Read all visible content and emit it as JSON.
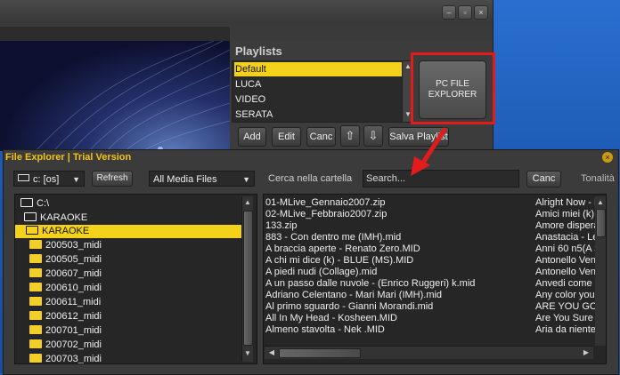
{
  "playlists": {
    "title": "Playlists",
    "items": [
      "Default",
      "LUCA",
      "VIDEO",
      "SERATA"
    ],
    "selected_index": 0,
    "buttons": {
      "add": "Add",
      "edit": "Edit",
      "canc": "Canc",
      "save": "Salva Playlist"
    }
  },
  "pc_explorer_button": {
    "line1": "PC FILE",
    "line2": "EXPLORER"
  },
  "file_explorer": {
    "title": "File Explorer | Trial Version",
    "drive": "c: [os]",
    "refresh": "Refresh",
    "filter": "All Media Files",
    "search_label": "Cerca nella cartella",
    "search_value": "Search...",
    "canc": "Canc",
    "tonality_label": "Tonalità",
    "tree": [
      {
        "label": "C:\\",
        "type": "open",
        "level": 0
      },
      {
        "label": "KARAOKE",
        "type": "open",
        "level": 0
      },
      {
        "label": "KARAOKE",
        "type": "open",
        "level": 1,
        "selected": true
      },
      {
        "label": "200503_midi",
        "type": "folder",
        "level": 2
      },
      {
        "label": "200505_midi",
        "type": "folder",
        "level": 2
      },
      {
        "label": "200607_midi",
        "type": "folder",
        "level": 2
      },
      {
        "label": "200610_midi",
        "type": "folder",
        "level": 2
      },
      {
        "label": "200611_midi",
        "type": "folder",
        "level": 2
      },
      {
        "label": "200612_midi",
        "type": "folder",
        "level": 2
      },
      {
        "label": "200701_midi",
        "type": "folder",
        "level": 2
      },
      {
        "label": "200702_midi",
        "type": "folder",
        "level": 2
      },
      {
        "label": "200703_midi",
        "type": "folder",
        "level": 2
      }
    ],
    "files": [
      {
        "name": "01-MLive_Gennaio2007.zip",
        "title": "Alright Now - Fre"
      },
      {
        "name": "02-MLive_Febbraio2007.zip",
        "title": "Amici miei (k) - N"
      },
      {
        "name": "133.zip",
        "title": "Amore disperato"
      },
      {
        "name": "883 - Con dentro me (IMH).mid",
        "title": "Anastacia - Left C"
      },
      {
        "name": "A braccia aperte - Renato Zero.MID",
        "title": "Anni 60 n5(A Sa"
      },
      {
        "name": "A chi mi dice (k) - BLUE (MS).MID",
        "title": "Antonello Vendit"
      },
      {
        "name": "A piedi nudi (Collage).mid",
        "title": "Antonello Vendit"
      },
      {
        "name": "A un passo dalle nuvole - (Enrico Ruggeri)  k.mid",
        "title": "Anvedi come bal"
      },
      {
        "name": "Adriano Celentano - Mari Mari (IMH).mid",
        "title": "Any color you li"
      },
      {
        "name": "Al primo sguardo  - Gianni Morandi.mid",
        "title": "ARE YOU GONNA"
      },
      {
        "name": "All In My Head - Kosheen.MID",
        "title": "Are You Sure He"
      },
      {
        "name": "Almeno stavolta - Nek .MID",
        "title": "Aria da niente -"
      }
    ]
  }
}
